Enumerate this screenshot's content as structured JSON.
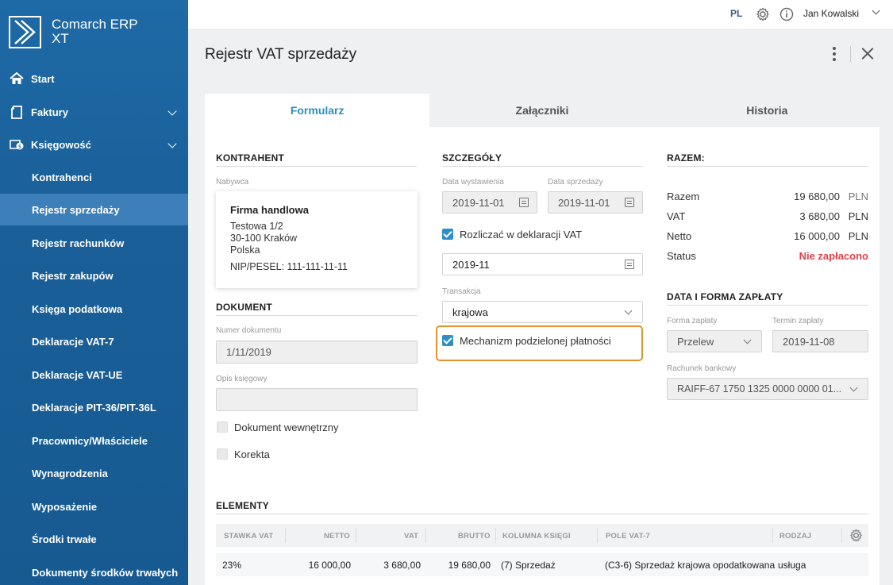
{
  "app": {
    "name_line1": "Comarch ERP",
    "name_line2": "XT"
  },
  "topbar": {
    "lang": "PL",
    "user": "Jan Kowalski"
  },
  "sidebar": {
    "items": [
      {
        "label": "Start",
        "icon": "home-icon"
      },
      {
        "label": "Faktury",
        "icon": "document-icon",
        "expandable": true
      },
      {
        "label": "Księgowość",
        "icon": "accounting-icon",
        "expandable": true
      },
      {
        "label": "Kontrahenci"
      },
      {
        "label": "Rejestr sprzedaży",
        "active": true
      },
      {
        "label": "Rejestr rachunków"
      },
      {
        "label": "Rejestr zakupów"
      },
      {
        "label": "Księga podatkowa"
      },
      {
        "label": "Deklaracje VAT-7"
      },
      {
        "label": "Deklaracje VAT-UE"
      },
      {
        "label": "Deklaracje PIT-36/PIT-36L"
      },
      {
        "label": "Pracownicy/Właściciele"
      },
      {
        "label": "Wynagrodzenia"
      },
      {
        "label": "Wyposażenie"
      },
      {
        "label": "Środki trwałe"
      },
      {
        "label": "Dokumenty środków trwałych"
      }
    ]
  },
  "page": {
    "title": "Rejestr VAT sprzedaży"
  },
  "tabs": [
    {
      "label": "Formularz",
      "active": true
    },
    {
      "label": "Załączniki"
    },
    {
      "label": "Historia"
    }
  ],
  "kontrahent": {
    "title": "KONTRAHENT",
    "buyer_label": "Nabywca",
    "name": "Firma handlowa",
    "address1": "Testowa 1/2",
    "address2": "30-100 Kraków",
    "country": "Polska",
    "nip": "NIP/PESEL: 111-111-11-11"
  },
  "dokument": {
    "title": "DOKUMENT",
    "number_label": "Numer dokumentu",
    "number_value": "1/11/2019",
    "desc_label": "Opis księgowy",
    "desc_value": "",
    "internal_label": "Dokument wewnętrzny",
    "correction_label": "Korekta"
  },
  "szczegoly": {
    "title": "SZCZEGÓŁY",
    "issue_date_label": "Data wystawienia",
    "issue_date": "2019-11-01",
    "sale_date_label": "Data sprzedaży",
    "sale_date": "2019-11-01",
    "vat_settle_label": "Rozliczać w deklaracji VAT",
    "vat_period": "2019-11",
    "transaction_label": "Transakcja",
    "transaction_value": "krajowa",
    "split_payment_label": "Mechanizm podzielonej płatności"
  },
  "razem": {
    "title": "RAZEM:",
    "rows": [
      {
        "label": "Razem",
        "value": "19 680,00",
        "currency": "PLN"
      },
      {
        "label": "VAT",
        "value": "3 680,00",
        "currency": "PLN"
      },
      {
        "label": "Netto",
        "value": "16 000,00",
        "currency": "PLN"
      }
    ],
    "status_label": "Status",
    "status_value": "Nie zapłacono"
  },
  "payment": {
    "title": "DATA I FORMA ZAPŁATY",
    "form_label": "Forma zapłaty",
    "form_value": "Przelew",
    "due_label": "Termin zapłaty",
    "due_value": "2019-11-08",
    "account_label": "Rachunek bankowy",
    "account_value": "RAIFF-67 1750 1325 0000 0000 01..."
  },
  "elementy": {
    "title": "ELEMENTY",
    "headers": [
      "STAWKA VAT",
      "NETTO",
      "VAT",
      "BRUTTO",
      "KOLUMNA KSIĘGI",
      "POLE VAT-7",
      "RODZAJ"
    ],
    "rows": [
      [
        "23%",
        "16 000,00",
        "3 680,00",
        "19 680,00",
        "(7) Sprzedaż",
        "(C3-6) Sprzedaż krajowa opodatkowana",
        "usługa"
      ]
    ]
  },
  "colors": {
    "accent": "#2e8fc6",
    "sidebar": "#1b62a0",
    "status_unpaid": "#e2404a",
    "highlight": "#e8912d"
  }
}
